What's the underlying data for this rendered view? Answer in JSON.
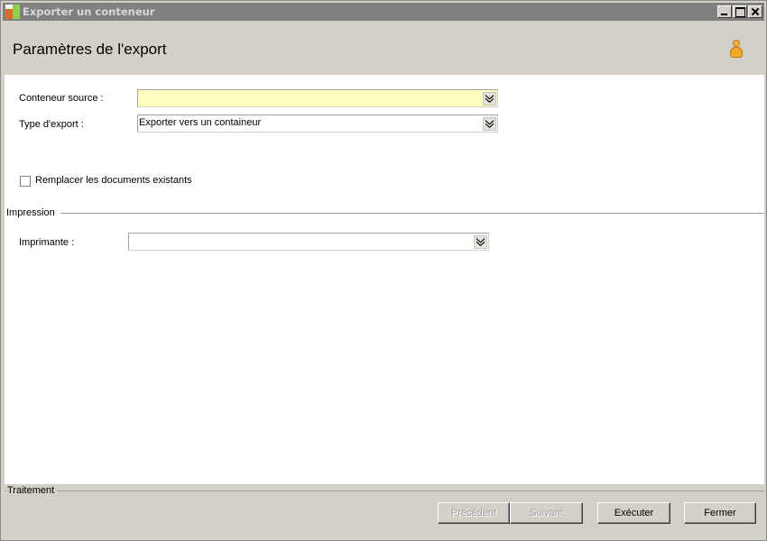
{
  "window": {
    "title": "Exporter un conteneur"
  },
  "header": {
    "title": "Paramètres de l'export",
    "user_icon": "user-icon"
  },
  "form": {
    "source_container": {
      "label": "Conteneur source :",
      "value": "",
      "highlight_color": "#ffffc0"
    },
    "export_type": {
      "label": "Type d'export :",
      "value": "Exporter vers un containeur"
    },
    "replace_documents": {
      "label": "Remplacer les documents existants",
      "checked": false
    }
  },
  "print_group": {
    "title": "Impression",
    "printer": {
      "label": "Imprimante :",
      "value": ""
    }
  },
  "footer": {
    "title": "Traitement",
    "buttons": {
      "previous": "Précédent",
      "next": "Suivant",
      "execute": "Exécuter",
      "close": "Fermer"
    }
  }
}
